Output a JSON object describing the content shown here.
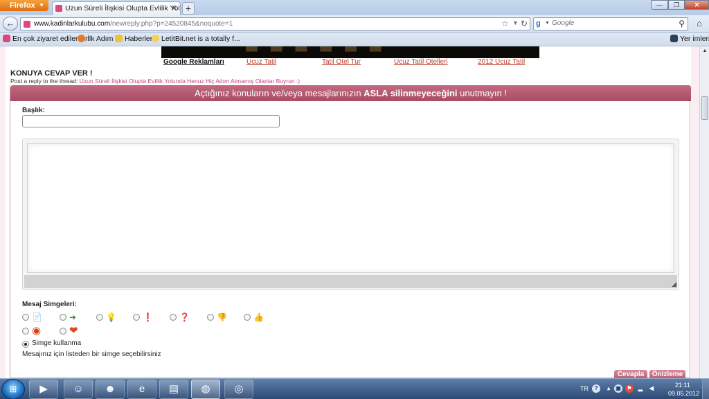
{
  "browser": {
    "menu_button": "Firefox",
    "tab_title": "Uzun Süreli İlişkisi Olupta Evlilik Yolunda...",
    "url_host": "www.kadinlarkulubu.com",
    "url_rest": "/newreply.php?p=24520845&noquote=1",
    "search_placeholder": "Google",
    "window_controls": {
      "minimize": "—",
      "maximize": "❐",
      "close": "✕"
    }
  },
  "bookmarks": {
    "items": [
      "En çok ziyaret edilenler",
      "İlk Adım",
      "Haberler",
      "LetitBit.net is a totally f..."
    ],
    "right": "Yer imleri"
  },
  "ads": {
    "title": "Google Reklamları",
    "links": [
      "Ucuz Tatil",
      "Tatil Otel Tur",
      "Ucuz Tatil Otelleri",
      "2012 Ucuz Tatil"
    ]
  },
  "reply": {
    "heading": "KONUYA CEVAP VER !",
    "subtitle_prefix": "Post a reply to the thread:",
    "thread_title": "Uzun Süreli İlişkisi Olupta Evlilik Yolunda Henuz Hiç Adım Atmamış Olanlar Buyrun :)",
    "warning_part1": "Açtığınız konuların ve/veya mesajlarınızın ",
    "warning_bold": "ASLA silinmeyeceğini",
    "warning_part2": " unutmayın !",
    "title_label": "Başlık:",
    "title_value": "",
    "message_value": "",
    "icons_label": "Mesaj Simgeleri:",
    "no_icon_label": "Simge kullanma",
    "hint": "Mesajınız için listeden bir simge seçebilirsiniz",
    "submit_label": "Cevapla",
    "preview_label": "Önizleme"
  },
  "message_icons": [
    {
      "name": "document-icon",
      "glyph": "📄",
      "color": "#555555"
    },
    {
      "name": "arrow-icon",
      "glyph": "➜",
      "color": "#3a8a2e"
    },
    {
      "name": "lightbulb-icon",
      "glyph": "💡",
      "color": "#e2b51c"
    },
    {
      "name": "exclamation-icon",
      "glyph": "❗",
      "color": "#c62828"
    },
    {
      "name": "question-icon",
      "glyph": "❓",
      "color": "#2d5fa8"
    },
    {
      "name": "thumbs-down-icon",
      "glyph": "👎",
      "color": "#c08a5a"
    },
    {
      "name": "thumbs-up-icon",
      "glyph": "👍",
      "color": "#c08a5a"
    },
    {
      "name": "lifebuoy-icon",
      "glyph": "◉",
      "color": "#d9411e"
    },
    {
      "name": "heart-icon",
      "glyph": "❤",
      "color": "#e0451f"
    }
  ],
  "taskbar": {
    "apps": [
      "windows-media-player",
      "messenger",
      "game",
      "internet-explorer",
      "file-explorer",
      "firefox",
      "other-app"
    ],
    "language": "TR",
    "time": "21:11",
    "date": "09.05.2012"
  },
  "colors": {
    "accent": "#b0566b",
    "link": "#c0392b"
  }
}
